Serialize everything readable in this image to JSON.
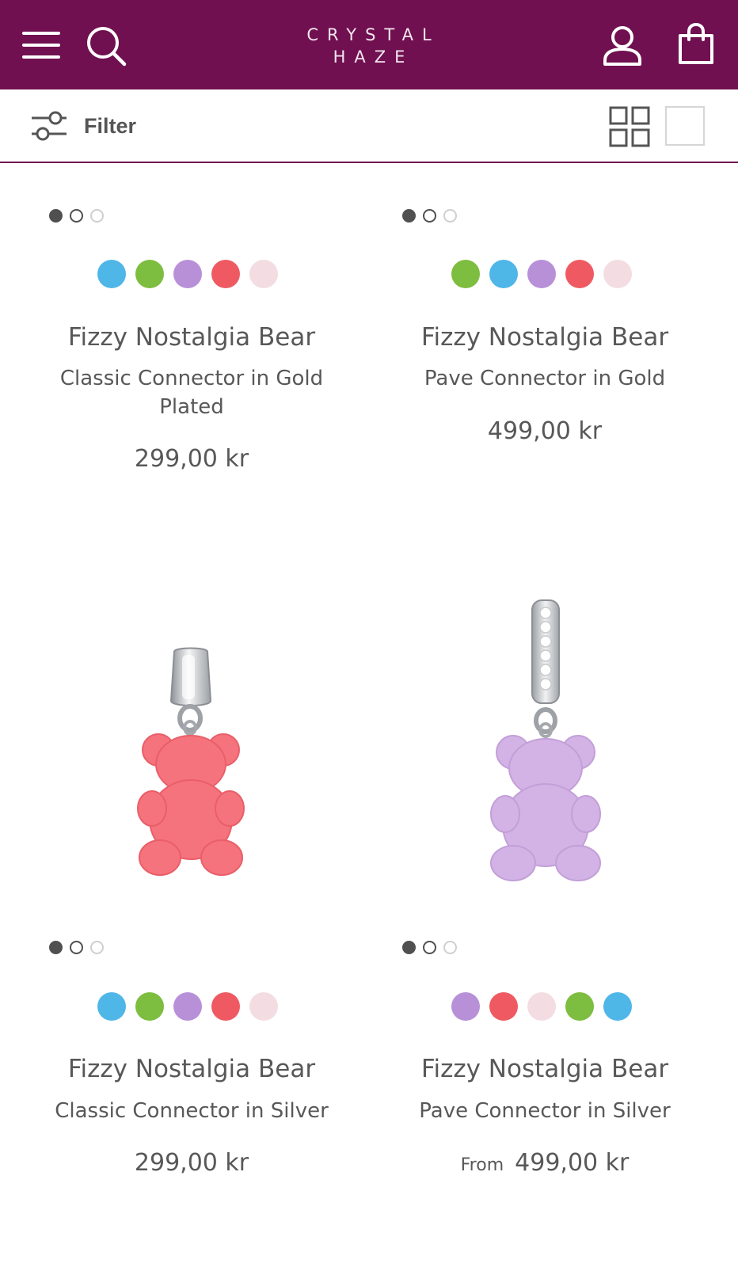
{
  "header": {
    "logo_line1": "CRYSTAL",
    "logo_line2": "HAZE",
    "colors": {
      "background": "#701050",
      "logo": "#f4e6ee"
    },
    "icons": [
      "menu-icon",
      "search-icon",
      "account-icon",
      "bag-icon"
    ]
  },
  "filterbar": {
    "filter_label": "Filter",
    "view_options": [
      "grid-view-icon",
      "single-view-icon"
    ]
  },
  "products": [
    {
      "name": "Fizzy Nostalgia Bear",
      "variant": "Classic Connector in Gold",
      "variant_line2": "Plated",
      "price": "299,00 kr",
      "swatches": [
        "#4fb6e8",
        "#7dbd3f",
        "#b890d8",
        "#ef5a62",
        "#f3dde2"
      ]
    },
    {
      "name": "Fizzy Nostalgia Bear",
      "variant": "Pave Connector in Gold",
      "price": "499,00 kr",
      "swatches": [
        "#7dbd3f",
        "#4fb6e8",
        "#b890d8",
        "#ef5a62",
        "#f3dde2"
      ]
    },
    {
      "name": "Fizzy Nostalgia Bear",
      "variant": "Classic Connector in Silver",
      "price": "299,00 kr",
      "swatches": [
        "#4fb6e8",
        "#7dbd3f",
        "#b890d8",
        "#ef5a62",
        "#f3dde2"
      ]
    },
    {
      "name": "Fizzy Nostalgia Bear",
      "variant": "Pave Connector in Silver",
      "price_prefix": "From",
      "price": "499,00 kr",
      "swatches": [
        "#b890d8",
        "#ef5a62",
        "#f3dde2",
        "#7dbd3f",
        "#4fb6e8"
      ]
    }
  ]
}
